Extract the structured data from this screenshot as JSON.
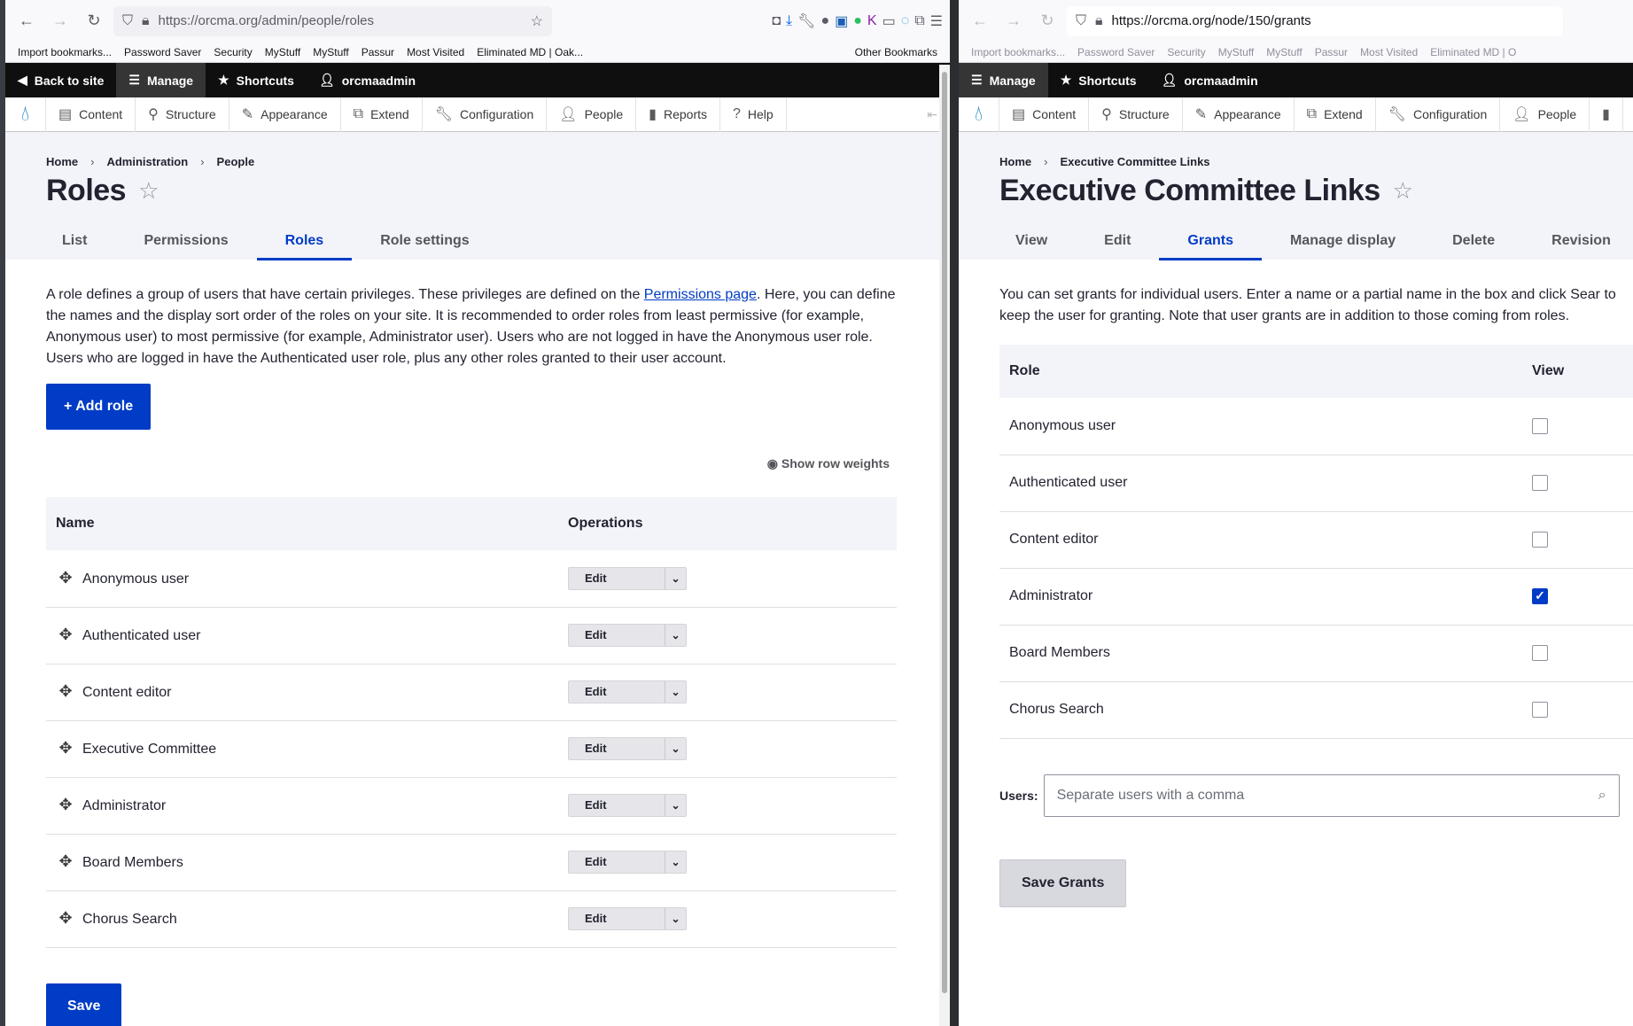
{
  "left": {
    "url_host": "https://orcma.org",
    "url_path": "/admin/people/roles",
    "bookmarks": [
      "Import bookmarks...",
      "Password Saver",
      "Security",
      "MyStuff",
      "MyStuff",
      "Passur",
      "Most Visited",
      "Eliminated MD | Oak...",
      "Other Bookmarks"
    ],
    "toolbar": {
      "back": "Back to site",
      "manage": "Manage",
      "shortcuts": "Shortcuts",
      "user": "orcmaadmin"
    },
    "tray": [
      "Content",
      "Structure",
      "Appearance",
      "Extend",
      "Configuration",
      "People",
      "Reports",
      "Help"
    ],
    "breadcrumb": [
      "Home",
      "Administration",
      "People"
    ],
    "title": "Roles",
    "tabs": [
      "List",
      "Permissions",
      "Roles",
      "Role settings"
    ],
    "description_pre": "A role defines a group of users that have certain privileges. These privileges are defined on the ",
    "description_link": "Permissions page",
    "description_post": ". Here, you can define the names and the display sort order of the roles on your site. It is recommended to order roles from least permissive (for example, Anonymous user) to most permissive (for example, Administrator user). Users who are not logged in have the Anonymous user role. Users who are logged in have the Authenticated user role, plus any other roles granted to their user account.",
    "add_role": "+ Add role",
    "row_weights": "Show row weights",
    "table_headers": [
      "Name",
      "Operations"
    ],
    "roles": [
      "Anonymous user",
      "Authenticated user",
      "Content editor",
      "Executive Committee",
      "Administrator",
      "Board Members",
      "Chorus Search"
    ],
    "edit_label": "Edit",
    "save": "Save"
  },
  "right": {
    "url_host": "https://orcma.org",
    "url_path": "/node/150/grants",
    "bookmarks": [
      "Import bookmarks...",
      "Password Saver",
      "Security",
      "MyStuff",
      "MyStuff",
      "Passur",
      "Most Visited",
      "Eliminated MD | O"
    ],
    "toolbar": {
      "manage": "Manage",
      "shortcuts": "Shortcuts",
      "user": "orcmaadmin"
    },
    "tray": [
      "Content",
      "Structure",
      "Appearance",
      "Extend",
      "Configuration",
      "People"
    ],
    "breadcrumb": [
      "Home",
      "Executive Committee Links"
    ],
    "title": "Executive Committee Links",
    "tabs": [
      "View",
      "Edit",
      "Grants",
      "Manage display",
      "Delete",
      "Revision"
    ],
    "description": "You can set grants for individual users. Enter a name or a partial name in the box and click Sear to keep the user for granting. Note that user grants are in addition to those coming from roles.",
    "table_headers": [
      "Role",
      "View"
    ],
    "grants": [
      {
        "role": "Anonymous user",
        "view": false
      },
      {
        "role": "Authenticated user",
        "view": false
      },
      {
        "role": "Content editor",
        "view": false
      },
      {
        "role": "Administrator",
        "view": true
      },
      {
        "role": "Board Members",
        "view": false
      },
      {
        "role": "Chorus Search",
        "view": false
      }
    ],
    "users_label": "Users:",
    "users_placeholder": "Separate users with a comma",
    "save_grants": "Save Grants"
  }
}
